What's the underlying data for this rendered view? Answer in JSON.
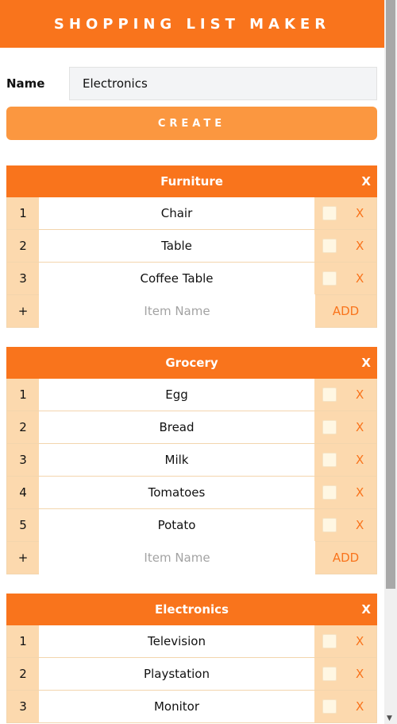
{
  "app": {
    "title": "SHOPPING LIST MAKER"
  },
  "form": {
    "name_label": "Name",
    "name_value": "Electronics",
    "create_label": "CREATE"
  },
  "lists": [
    {
      "title": "Furniture",
      "close": "X",
      "items": [
        {
          "num": "1",
          "name": "Chair",
          "delete": "X"
        },
        {
          "num": "2",
          "name": "Table",
          "delete": "X"
        },
        {
          "num": "3",
          "name": "Coffee Table",
          "delete": "X"
        }
      ],
      "add": {
        "plus": "+",
        "placeholder": "Item Name",
        "button": "ADD"
      }
    },
    {
      "title": "Grocery",
      "close": "X",
      "items": [
        {
          "num": "1",
          "name": "Egg",
          "delete": "X"
        },
        {
          "num": "2",
          "name": "Bread",
          "delete": "X"
        },
        {
          "num": "3",
          "name": "Milk",
          "delete": "X"
        },
        {
          "num": "4",
          "name": "Tomatoes",
          "delete": "X"
        },
        {
          "num": "5",
          "name": "Potato",
          "delete": "X"
        }
      ],
      "add": {
        "plus": "+",
        "placeholder": "Item Name",
        "button": "ADD"
      }
    },
    {
      "title": "Electronics",
      "close": "X",
      "items": [
        {
          "num": "1",
          "name": "Television",
          "delete": "X"
        },
        {
          "num": "2",
          "name": "Playstation",
          "delete": "X"
        },
        {
          "num": "3",
          "name": "Monitor",
          "delete": "X"
        }
      ]
    }
  ],
  "colors": {
    "accent": "#f9741c",
    "button": "#fb9740",
    "cell": "#fcd9ae"
  },
  "icons": {
    "scroll_down": "triangle-down-icon"
  }
}
